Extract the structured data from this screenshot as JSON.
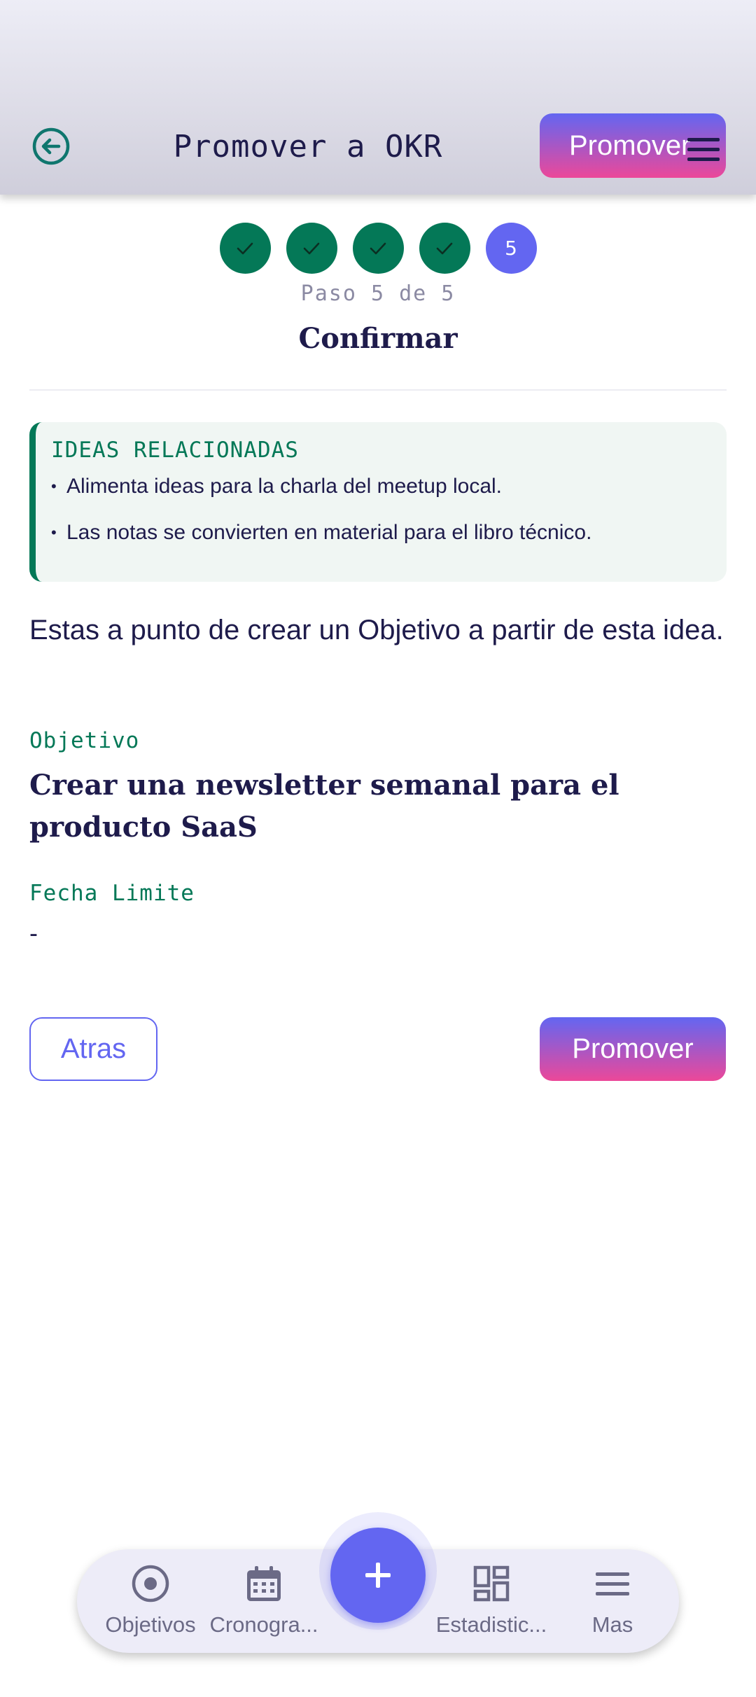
{
  "header": {
    "title": "Promover a OKR",
    "promote_label": "Promover"
  },
  "stepper": {
    "steps": [
      "",
      "",
      "",
      "",
      "5"
    ],
    "counter": "Paso 5 de 5",
    "title": "Confirmar"
  },
  "related_ideas": {
    "title": "IDEAS RELACIONADAS",
    "items": [
      "Alimenta ideas para la charla del meetup local.",
      "Las notas se convierten en material para el libro técnico."
    ]
  },
  "intro": "Estas a punto de crear un Objetivo a partir de esta idea.",
  "objective": {
    "label": "Objetivo",
    "value": "Crear una newsletter semanal para el producto SaaS"
  },
  "deadline": {
    "label": "Fecha Limite",
    "value": "-"
  },
  "actions": {
    "back_label": "Atras",
    "promote_label": "Promover"
  },
  "bottom_nav": {
    "items": [
      {
        "label": "Objetivos",
        "icon": "target-icon"
      },
      {
        "label": "Cronogra...",
        "icon": "calendar-icon"
      },
      {
        "label": "Estadistic...",
        "icon": "dashboard-icon"
      },
      {
        "label": "Mas",
        "icon": "menu-icon"
      }
    ],
    "fab_icon": "plus-icon"
  },
  "colors": {
    "primary": "#6366f1",
    "accent_pink": "#ec4899",
    "success_green": "#047857",
    "text_dark": "#1e1b4b"
  }
}
